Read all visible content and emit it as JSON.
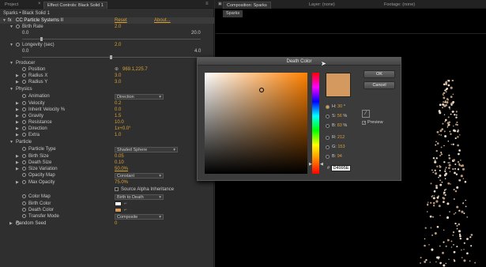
{
  "top_tabs": {
    "project": "Project",
    "effect_controls": "Effect Controls: Black Solid 1",
    "composition": "Composition: Sparks",
    "layer": "Layer: (none)",
    "footage": "Footage: (none)"
  },
  "ec_breadcrumb": "Sparks • Black Solid 1",
  "comp_subtab": "Sparks",
  "effect": {
    "fx_badge": "fx",
    "name": "CC Particle Systems II",
    "reset": "Reset",
    "about": "About..."
  },
  "params": {
    "birth_rate": {
      "label": "Birth Rate",
      "value": "2.0",
      "min": "0.0",
      "max": "20.0"
    },
    "longevity": {
      "label": "Longevity (sec)",
      "value": "2.0",
      "min": "0.0",
      "max": "4.0"
    },
    "producer": "Producer",
    "position": {
      "label": "Position",
      "value": "969.1,225.7"
    },
    "radius_x": {
      "label": "Radius X",
      "value": "3.0"
    },
    "radius_y": {
      "label": "Radius Y",
      "value": "3.0"
    },
    "physics": "Physics",
    "animation": {
      "label": "Animation",
      "value": "Direction"
    },
    "velocity": {
      "label": "Velocity",
      "value": "0.2"
    },
    "inherit_velocity": {
      "label": "Inherit Velocity %",
      "value": "0.0"
    },
    "gravity": {
      "label": "Gravity",
      "value": "1.5"
    },
    "resistance": {
      "label": "Resistance",
      "value": "10.0"
    },
    "direction": {
      "label": "Direction",
      "value": "1x+0.0°"
    },
    "extra": {
      "label": "Extra",
      "value": "1.0"
    },
    "particle": "Particle",
    "particle_type": {
      "label": "Particle Type",
      "value": "Shaded Sphere"
    },
    "birth_size": {
      "label": "Birth Size",
      "value": "0.05"
    },
    "death_size": {
      "label": "Death Size",
      "value": "0.10"
    },
    "size_variation": {
      "label": "Size Variation",
      "value": "50.0%"
    },
    "opacity_map": {
      "label": "Opacity Map",
      "value": "Constant"
    },
    "max_opacity": {
      "label": "Max Opacity",
      "value": "75.0%"
    },
    "source_alpha": {
      "label": "Source Alpha Inheritance"
    },
    "color_map": {
      "label": "Color Map",
      "value": "Birth to Death"
    },
    "birth_color": {
      "label": "Birth Color"
    },
    "death_color": {
      "label": "Death Color"
    },
    "transfer_mode": {
      "label": "Transfer Mode",
      "value": "Composite"
    },
    "random_seed": {
      "label": "Random Seed",
      "value": "0"
    }
  },
  "colors": {
    "accent": "#d9a033",
    "death_color": "#d4995e",
    "birth_color": "#ffffff"
  },
  "dialog": {
    "title": "Death Color",
    "ok": "OK",
    "cancel": "Cancel",
    "h_label": "H:",
    "h_value": "30",
    "h_unit": "°",
    "s_label": "S:",
    "s_value": "56",
    "s_unit": "%",
    "b_label": "B:",
    "b_value": "83",
    "b_unit": "%",
    "r_label": "R:",
    "r_value": "212",
    "g_label": "G:",
    "g_value": "153",
    "bl_label": "B:",
    "bl_value": "94",
    "hex_label": "#",
    "hex_value": "D4995E",
    "preview": "Preview",
    "selected": "h"
  }
}
